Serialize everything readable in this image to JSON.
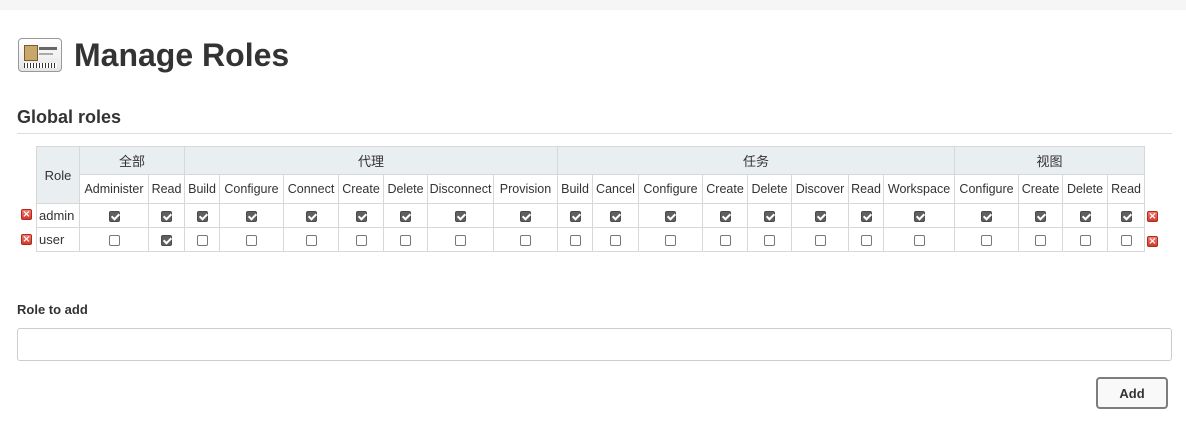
{
  "page": {
    "title": "Manage Roles",
    "header_icon": "id-card-icon"
  },
  "global_roles": {
    "title": "Global roles",
    "role_header": "Role",
    "groups": [
      {
        "label": "全部",
        "perms": [
          "Administer",
          "Read"
        ]
      },
      {
        "label": "代理",
        "perms": [
          "Build",
          "Configure",
          "Connect",
          "Create",
          "Delete",
          "Disconnect",
          "Provision"
        ]
      },
      {
        "label": "任务",
        "perms": [
          "Build",
          "Cancel",
          "Configure",
          "Create",
          "Delete",
          "Discover",
          "Read",
          "Workspace"
        ]
      },
      {
        "label": "视图",
        "perms": [
          "Configure",
          "Create",
          "Delete",
          "Read"
        ]
      }
    ],
    "rows": [
      {
        "name": "admin",
        "checks": [
          true,
          true,
          true,
          true,
          true,
          true,
          true,
          true,
          true,
          true,
          true,
          true,
          true,
          true,
          true,
          true,
          true,
          true,
          true,
          true,
          true
        ]
      },
      {
        "name": "user",
        "checks": [
          false,
          true,
          false,
          false,
          false,
          false,
          false,
          false,
          false,
          false,
          false,
          false,
          false,
          false,
          false,
          false,
          false,
          false,
          false,
          false,
          false
        ]
      }
    ],
    "delete_icon": "delete-x-icon"
  },
  "add_role": {
    "label": "Role to add",
    "value": "",
    "placeholder": "",
    "button_label": "Add"
  },
  "colors": {
    "header_bg": "#e9eef0",
    "delete_red": "#d23a2c",
    "checkbox_checked": "#5f5f5f"
  }
}
